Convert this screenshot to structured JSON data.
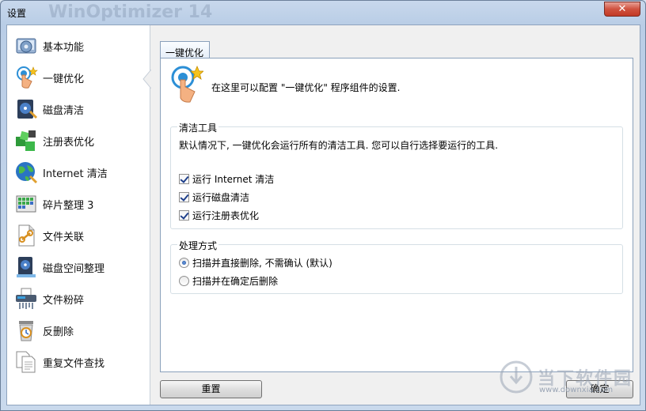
{
  "window": {
    "title": "设置",
    "ghost_title": "WinOptimizer 14",
    "close_label": "✕"
  },
  "sidebar": {
    "items": [
      {
        "label": "基本功能",
        "icon": "basic-functions-icon"
      },
      {
        "label": "一键优化",
        "icon": "one-click-optimize-icon"
      },
      {
        "label": "磁盘清洁",
        "icon": "disk-cleaner-icon"
      },
      {
        "label": "注册表优化",
        "icon": "registry-optimize-icon"
      },
      {
        "label": "Internet 清洁",
        "icon": "internet-cleaner-icon"
      },
      {
        "label": "碎片整理 3",
        "icon": "defrag-icon"
      },
      {
        "label": "文件关联",
        "icon": "file-association-icon"
      },
      {
        "label": "磁盘空间整理",
        "icon": "disk-space-icon"
      },
      {
        "label": "文件粉碎",
        "icon": "file-shredder-icon"
      },
      {
        "label": "反删除",
        "icon": "undelete-icon"
      },
      {
        "label": "重复文件查找",
        "icon": "duplicate-finder-icon"
      }
    ],
    "selected": 1
  },
  "tab": {
    "label": "一键优化"
  },
  "panel": {
    "description": "在这里可以配置 \"一键优化\" 程序组件的设置.",
    "cleaning_tools": {
      "title": "清洁工具",
      "description": "默认情况下, 一键优化会运行所有的清洁工具. 您可以自行选择要运行的工具.",
      "options": [
        {
          "label": "运行 Internet 清洁",
          "checked": true
        },
        {
          "label": "运行磁盘清洁",
          "checked": true
        },
        {
          "label": "运行注册表优化",
          "checked": true
        }
      ]
    },
    "processing": {
      "title": "处理方式",
      "options": [
        {
          "label": "扫描并直接删除, 不需确认 (默认)",
          "selected": true
        },
        {
          "label": "扫描并在确定后删除",
          "selected": false
        }
      ]
    }
  },
  "buttons": {
    "reset": "重置",
    "ok": "确定"
  },
  "watermark": {
    "text": "当下软件园",
    "sub": "www.downxia.com"
  },
  "colors": {
    "accent": "#1b4aa0",
    "close": "#c23a26"
  }
}
